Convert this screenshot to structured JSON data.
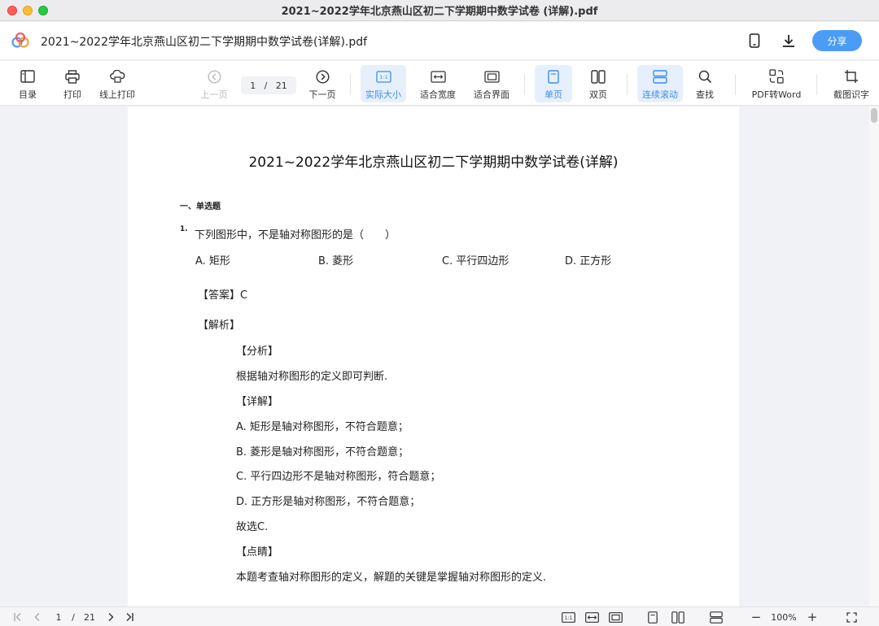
{
  "window": {
    "title": "2021~2022学年北京燕山区初二下学期期中数学试卷 (详解).pdf"
  },
  "header": {
    "doc_name": "2021~2022学年北京燕山区初二下学期期中数学试卷(详解).pdf",
    "share_label": "分享",
    "icons": [
      "app-logo-icon",
      "phone-icon",
      "download-icon"
    ]
  },
  "toolbar": {
    "toc": "目录",
    "print": "打印",
    "online_print": "线上打印",
    "prev_page": "上一页",
    "current_page": "1",
    "page_sep": "/",
    "total_pages": "21",
    "next_page": "下一页",
    "actual_size": "实际大小",
    "fit_width": "适合宽度",
    "fit_page": "适合界面",
    "single_page": "单页",
    "double_page": "双页",
    "continuous_scroll": "连续滚动",
    "find": "查找",
    "pdf_to_word": "PDF转Word",
    "ocr": "截图识字",
    "badge_11": "1:1"
  },
  "document": {
    "title": "2021~2022学年北京燕山区初二下学期期中数学试卷(详解)",
    "section": "一、单选题",
    "question_num": "1.",
    "question": "下列图形中，不是轴对称图形的是（　　）",
    "options": [
      "A. 矩形",
      "B. 菱形",
      "C. 平行四边形",
      "D. 正方形"
    ],
    "answer": "【答案】C",
    "analysis_header": "【解析】",
    "fenxi": "【分析】",
    "fenxi_text": "根据轴对称图形的定义即可判断.",
    "xiangjie": "【详解】",
    "details": [
      "A. 矩形是轴对称图形，不符合题意；",
      "B. 菱形是轴对称图形，不符合题意；",
      "C. 平行四边形不是轴对称图形，符合题意；",
      "D. 正方形是轴对称图形，不符合题意；",
      "故选C."
    ],
    "dianjing": "【点睛】",
    "dianjing_text": "本题考查轴对称图形的定义，解题的关键是掌握轴对称图形的定义."
  },
  "statusbar": {
    "current_page": "1",
    "page_sep": "/",
    "total_pages": "21",
    "zoom": "100%",
    "badge_11": "1:1",
    "zoom_out": "−",
    "zoom_in": "+"
  },
  "colors": {
    "accent": "#3c8bf0",
    "share": "#4b9cf6",
    "active_bg": "#e6f0fd"
  }
}
